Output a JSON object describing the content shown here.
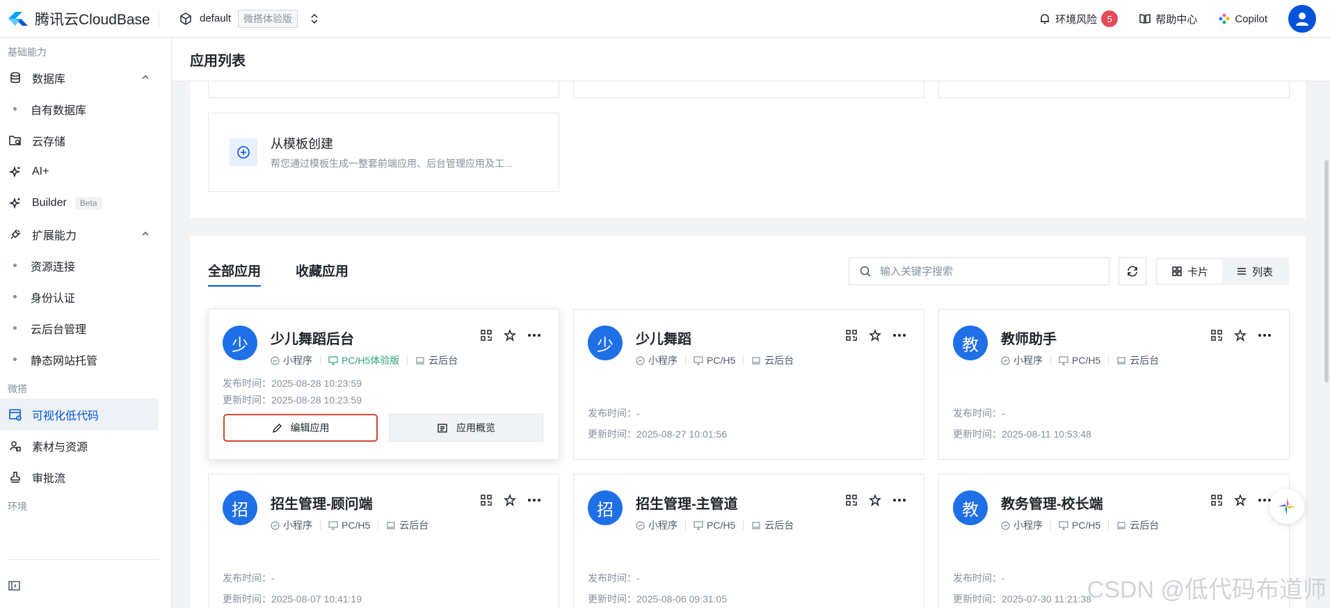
{
  "header": {
    "brand": "腾讯云CloudBase",
    "env_name": "default",
    "env_tag": "微搭体验版",
    "risk_label": "环境风险",
    "risk_count": "5",
    "help_label": "帮助中心",
    "copilot_label": "Copilot"
  },
  "sidebar": {
    "group_basic": "基础能力",
    "database": "数据库",
    "own_database": "自有数据库",
    "storage": "云存储",
    "ai": "AI+",
    "builder": "Builder",
    "builder_badge": "Beta",
    "extensions": "扩展能力",
    "resource_connect": "资源连接",
    "auth": "身份认证",
    "backend_mgmt": "云后台管理",
    "static_hosting": "静态网站托管",
    "group_weida": "微搭",
    "lowcode": "可视化低代码",
    "materials": "素材与资源",
    "approval": "审批流",
    "group_env": "环境"
  },
  "page": {
    "title": "应用列表"
  },
  "template": {
    "title": "从模板创建",
    "desc": "帮您通过模板生成一整套前端应用、后台管理应用及工..."
  },
  "list": {
    "tab_all": "全部应用",
    "tab_fav": "收藏应用",
    "search_placeholder": "输入关键字搜索",
    "view_card": "卡片",
    "view_list": "列表"
  },
  "card_labels": {
    "miniprogram": "小程序",
    "pch5": "PC/H5",
    "pch5_trial": "PC/H5体验版",
    "backend": "云后台",
    "publish_prefix": "发布时间：",
    "update_prefix": "更新时间：",
    "edit": "编辑应用",
    "overview": "应用概览"
  },
  "apps": [
    {
      "avatar": "少",
      "name": "少儿舞蹈后台",
      "publish": "2025-08-28 10:23:59",
      "update": "2025-08-28 10:23:59"
    },
    {
      "avatar": "少",
      "name": "少儿舞蹈",
      "publish": "-",
      "update": "2025-08-27 10:01:56"
    },
    {
      "avatar": "教",
      "name": "教师助手",
      "publish": "-",
      "update": "2025-08-11 10:53:48"
    },
    {
      "avatar": "招",
      "name": "招生管理-顾问端",
      "publish": "-",
      "update": "2025-08-07 10:41:19"
    },
    {
      "avatar": "招",
      "name": "招生管理-主管道",
      "publish": "-",
      "update": "2025-08-06 09:31:05"
    },
    {
      "avatar": "教",
      "name": "教务管理-校长端",
      "publish": "-",
      "update": "2025-07-30 11:21:38"
    }
  ],
  "watermark": "CSDN @低代码布道师",
  "colors": {
    "accent": "#0052d9",
    "highlight": "#d2452f",
    "green": "#2ba471",
    "avatar": "#1f6fe6"
  }
}
